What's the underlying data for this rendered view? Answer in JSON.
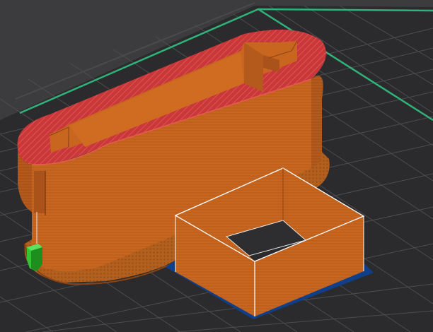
{
  "viewport": {
    "name": "3d-print-preview",
    "colors": {
      "background": "#3c3c3e",
      "bed": "#2b2b2d",
      "grid": "#505054",
      "bed_edge_highlight": "#2fb37a",
      "model_wall": "#c8661f",
      "model_wall_dark": "#a9531a",
      "model_shadow": "#8a4414",
      "top_infill": "#c8383a",
      "top_infill_line": "#e65a52",
      "first_layer_skirt": "#0f3f8a",
      "wipe_tower": "#33c433",
      "travel_move": "#e8e8e8"
    },
    "objects": [
      {
        "name": "rounded-enclosure-body"
      },
      {
        "name": "square-frame-part"
      },
      {
        "name": "wipe-tower"
      }
    ]
  }
}
